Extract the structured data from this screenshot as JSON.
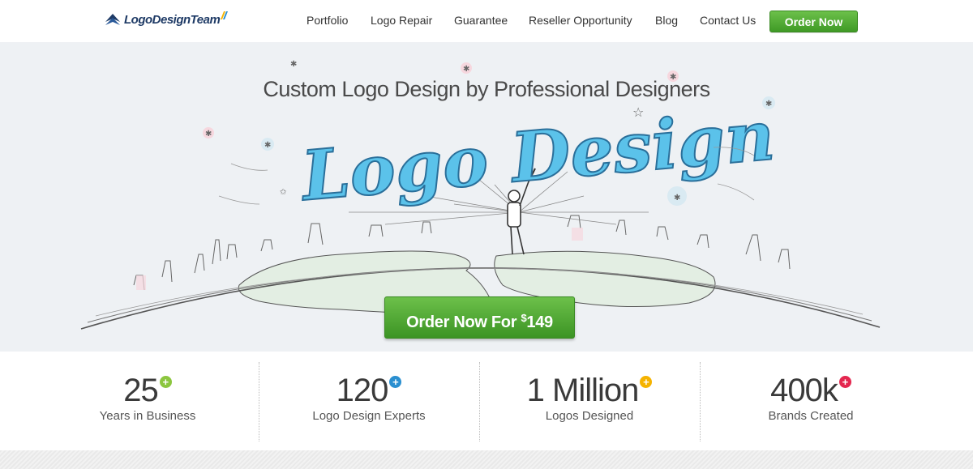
{
  "header": {
    "logo_text": "LogoDesignTeam",
    "nav": [
      {
        "label": "Portfolio"
      },
      {
        "label": "Logo Repair"
      },
      {
        "label": "Guarantee"
      },
      {
        "label": "Reseller Opportunity"
      },
      {
        "label": "Blog"
      },
      {
        "label": "Contact Us"
      }
    ],
    "order_button": "Order Now"
  },
  "hero": {
    "title": "Custom Logo Design by Professional Designers",
    "script_text": "Logo Design",
    "cta_label": "Order Now For ",
    "cta_currency": "$",
    "cta_price": "149"
  },
  "stats": [
    {
      "value": "25",
      "label": "Years in Business",
      "badge_color": "#8cc63f"
    },
    {
      "value": "120",
      "label": "Logo Design Experts",
      "badge_color": "#2a8fd0"
    },
    {
      "value": "1 Million",
      "label": "Logos Designed",
      "badge_color": "#f5b300"
    },
    {
      "value": "400k",
      "label": "Brands Created",
      "badge_color": "#e4274f"
    }
  ],
  "colors": {
    "accent_green": "#4caf2f",
    "brand_navy": "#1f3b66",
    "script_blue": "#5bc2ea"
  }
}
